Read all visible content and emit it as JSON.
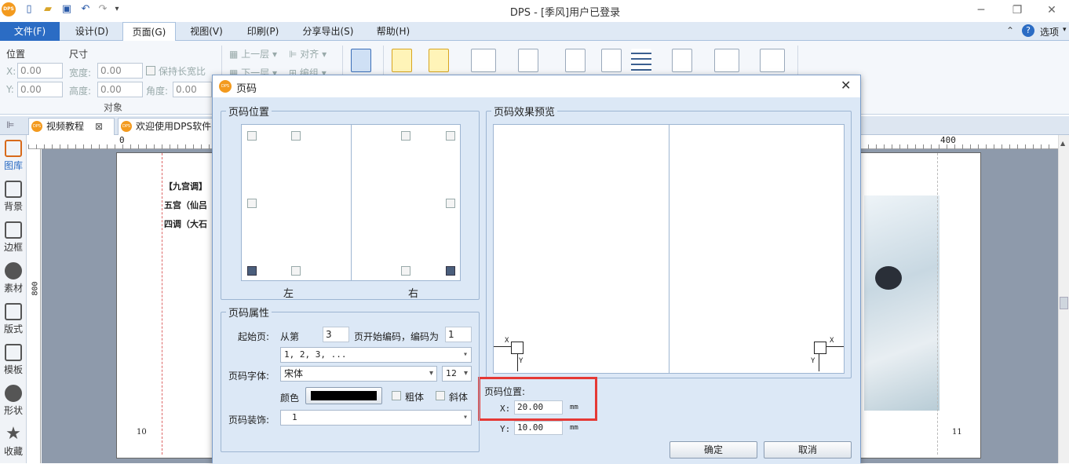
{
  "app": {
    "logo_text": "DPS",
    "title": "DPS - [季风]用户已登录"
  },
  "menu": {
    "file": "文件(F)",
    "design": "设计(D)",
    "page": "页面(G)",
    "view": "视图(V)",
    "print": "印刷(P)",
    "share": "分享导出(S)",
    "help": "帮助(H)",
    "options": "选项"
  },
  "ribbon": {
    "position_label": "位置",
    "size_label": "尺寸",
    "x_label": "X:",
    "y_label": "Y:",
    "x_value": "0.00",
    "y_value": "0.00",
    "width_label": "宽度:",
    "height_label": "高度:",
    "width_value": "0.00",
    "height_value": "0.00",
    "keep_ratio": "保持长宽比",
    "angle_label": "角度:",
    "angle_value": "0.00",
    "group_label": "对象",
    "up_layer": "上一层",
    "down_layer": "下一层",
    "align": "对齐",
    "edit": "编组"
  },
  "doc_tabs": [
    {
      "label": "视频教程"
    },
    {
      "label": "欢迎使用DPS软件"
    }
  ],
  "left_tools": [
    "图库",
    "背景",
    "边框",
    "素材",
    "版式",
    "模板",
    "形状",
    "收藏"
  ],
  "ruler": {
    "t0": "0",
    "t400": "400",
    "v800": "800"
  },
  "page": {
    "line1": "【九宫调】",
    "line2": "五宫（仙吕",
    "line3": "四调（大石",
    "left_num": "10",
    "right_num": "11"
  },
  "dialog": {
    "title": "页码",
    "pos_group": "页码位置",
    "left": "左",
    "right": "右",
    "preview_group": "页码效果预览",
    "props_group": "页码属性",
    "start_page": "起始页:",
    "from": "从第",
    "start_value": "3",
    "begin_text": "页开始编码，编码为",
    "code_value": "1",
    "format_value": "1, 2, 3, ...",
    "font_label": "页码字体:",
    "font_value": "宋体",
    "font_size": "12",
    "color_label": "颜色",
    "bold": "粗体",
    "italic": "斜体",
    "decor_label": "页码装饰:",
    "decor_value": "1",
    "pagepos_label": "页码位置:",
    "x_label": "X:",
    "x_value": "20.00",
    "y_label": "Y:",
    "y_value": "10.00",
    "unit": "mm",
    "ok": "确定",
    "cancel": "取消",
    "axis_x": "X",
    "axis_y": "Y"
  },
  "colors": {
    "accent": "#2b6cc4",
    "highlight": "#e53935",
    "logo": "#f39a1e"
  }
}
